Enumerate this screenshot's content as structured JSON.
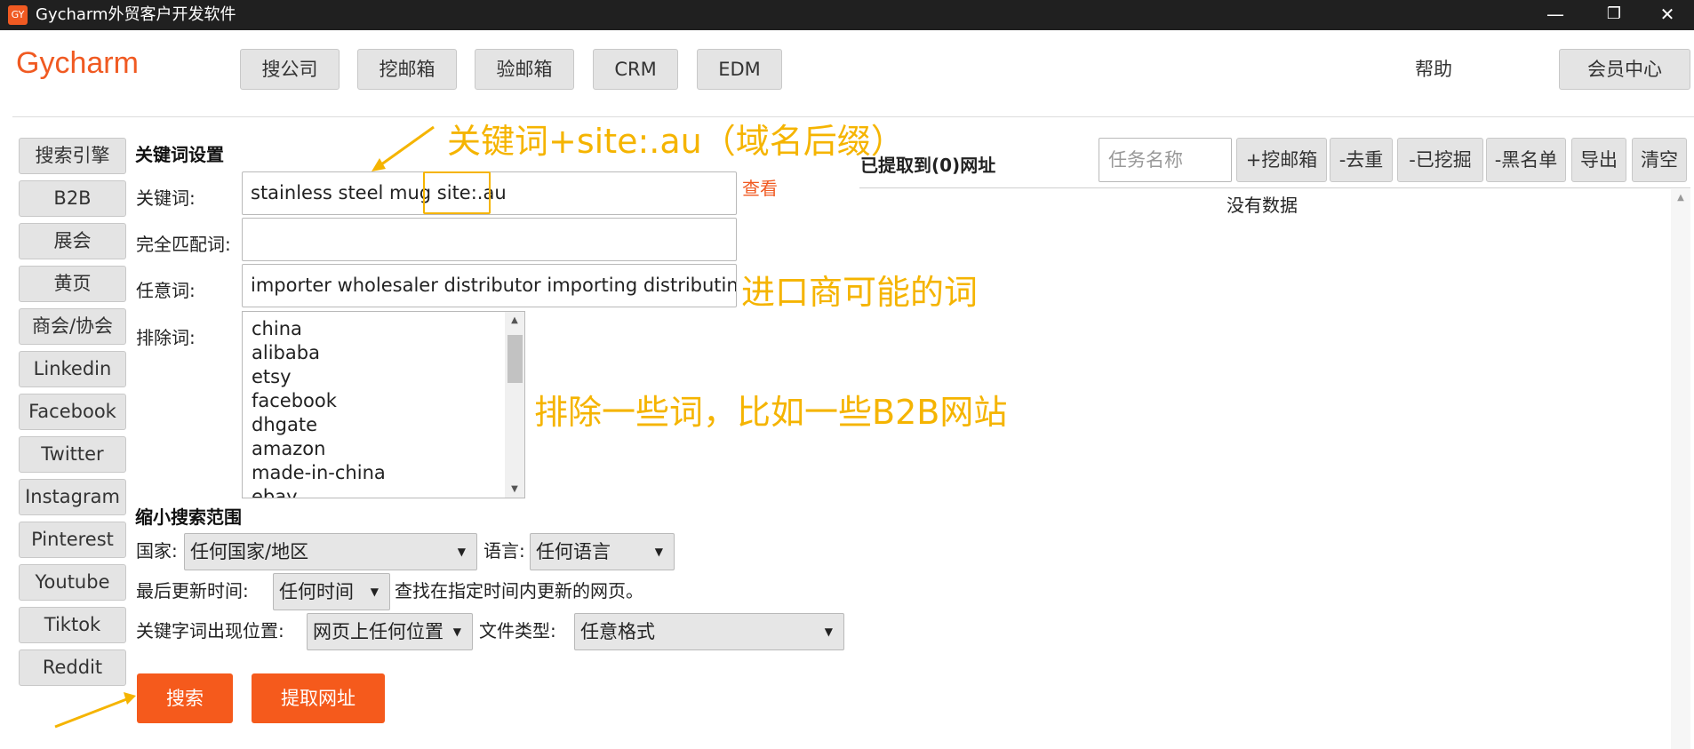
{
  "window": {
    "icon_text": "GY",
    "title": "Gycharm外贸客户开发软件",
    "controls": {
      "minimize": "—",
      "restore": "❐",
      "close": "✕"
    }
  },
  "header": {
    "brand": "Gycharm",
    "nav": [
      "搜公司",
      "挖邮箱",
      "验邮箱",
      "CRM",
      "EDM"
    ],
    "help": "帮助",
    "member_center": "会员中心"
  },
  "sidebar": {
    "items": [
      "搜索引擎",
      "B2B",
      "展会",
      "黄页",
      "商会/协会",
      "Linkedin",
      "Facebook",
      "Twitter",
      "Instagram",
      "Pinterest",
      "Youtube",
      "Tiktok",
      "Reddit"
    ]
  },
  "keyword_settings": {
    "title": "关键词设置",
    "keyword_label": "关键词:",
    "keyword_value": "stainless steel mug site:.au",
    "view_link": "查看",
    "exact_label": "完全匹配词:",
    "exact_value": "",
    "any_label": "任意词:",
    "any_value": "importer wholesaler distributor importing distributing",
    "exclude_label": "排除词:",
    "exclude_words": [
      "china",
      "alibaba",
      "etsy",
      "facebook",
      "dhgate",
      "amazon",
      "made-in-china",
      "ebay"
    ]
  },
  "narrow": {
    "title": "缩小搜索范围",
    "country_label": "国家:",
    "country_value": "任何国家/地区",
    "language_label": "语言:",
    "language_value": "任何语言",
    "updated_label": "最后更新时间:",
    "updated_value": "任何时间",
    "updated_hint": "查找在指定时间内更新的网页。",
    "position_label": "关键字词出现位置:",
    "position_value": "网页上任何位置",
    "filetype_label": "文件类型:",
    "filetype_value": "任意格式"
  },
  "actions": {
    "search": "搜索",
    "extract": "提取网址"
  },
  "annotations": {
    "keyword_tip": "关键词+site:.au（域名后缀）",
    "any_tip": "进口商可能的词",
    "exclude_tip": "排除一些词，比如一些B2B网站"
  },
  "results": {
    "title": "已提取到(0)网址",
    "task_placeholder": "任务名称",
    "buttons": [
      "+挖邮箱",
      "-去重",
      "-已挖掘",
      "-黑名单",
      "导出",
      "清空"
    ],
    "empty_text": "没有数据"
  },
  "colors": {
    "brand": "#f05a22",
    "accent_button": "#f55a1c",
    "annotation": "#f5b400"
  }
}
